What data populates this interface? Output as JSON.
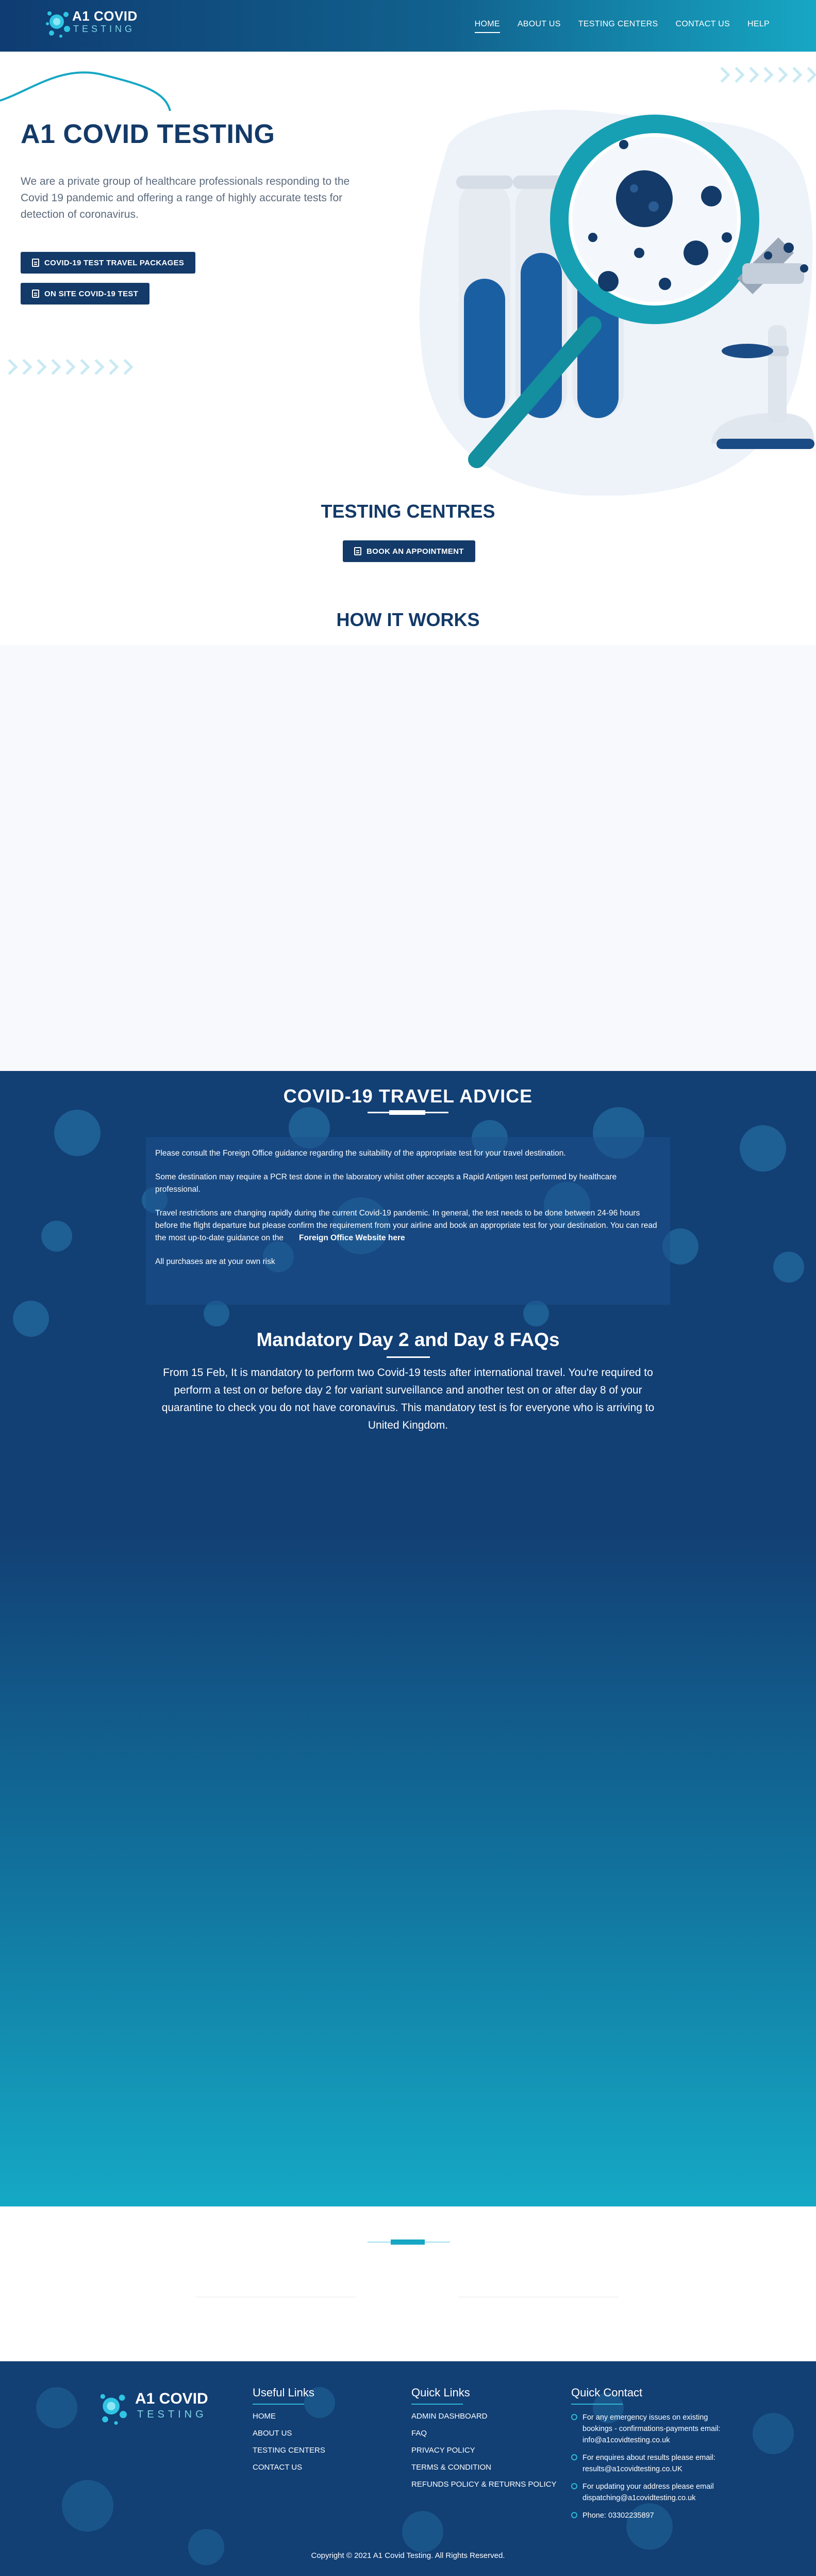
{
  "brand": {
    "name": "A1 COVID",
    "tagline": "TESTING"
  },
  "nav": {
    "items": [
      {
        "label": "HOME",
        "active": true
      },
      {
        "label": "ABOUT US"
      },
      {
        "label": "TESTING CENTERS"
      },
      {
        "label": "CONTACT US"
      },
      {
        "label": "HELP"
      }
    ]
  },
  "hero": {
    "title": "A1 COVID TESTING",
    "text": "We are a private group of healthcare professionals responding to the Covid 19 pandemic and offering a range of highly accurate tests for detection of coronavirus.",
    "button_packages": "COVID-19 TEST TRAVEL PACKAGES",
    "button_onsite": "ON SITE COVID-19 TEST"
  },
  "centres": {
    "title": "TESTING CENTRES",
    "button": "BOOK AN APPOINTMENT"
  },
  "how": {
    "title": "HOW IT WORKS"
  },
  "advice": {
    "title": "COVID-19 TRAVEL ADVICE",
    "p1": "Please consult the Foreign Office guidance regarding the suitability of the appropriate test for your travel destination.",
    "p2": "Some destination may require a PCR test done in the laboratory whilst other accepts a Rapid Antigen test performed by healthcare professional.",
    "p3": "Travel restrictions are changing rapidly during the current Covid-19 pandemic. In general, the test needs to be done between 24-96 hours before the flight departure but please confirm the requirement from your airline and book an appropriate test for your destination. You can read the most up-to-date guidance on the",
    "p3_link": "Foreign Office Website here",
    "p4": "All purchases are at your own risk"
  },
  "faq": {
    "title": "Mandatory Day 2 and Day 8 FAQs",
    "text": "From 15 Feb, It is mandatory to perform two Covid-19 tests after international travel. You're required to perform a test on or before day 2 for variant surveillance and another test on or after day 8 of your quarantine to check you do not have coronavirus. This mandatory test is for everyone who is arriving to United Kingdom."
  },
  "footer": {
    "useful": {
      "title": "Useful Links",
      "links": [
        "HOME",
        "ABOUT US",
        "TESTING CENTERS",
        "CONTACT US"
      ]
    },
    "quick": {
      "title": "Quick Links",
      "links": [
        "ADMIN DASHBOARD",
        "FAQ",
        "PRIVACY POLICY",
        "TERMS & CONDITION",
        "REFUNDS POLICY & RETURNS POLICY"
      ]
    },
    "contact": {
      "title": "Quick Contact",
      "items": [
        "For any emergency issues on existing bookings - confirmations-payments email: info@a1covidtesting.co.uk",
        "For enquires about results please email: results@a1covidtesting.co.UK",
        "For updating your address please email dispatching@a1covidtesting.co.uk",
        "Phone: 03302235897"
      ]
    },
    "copyright": "Copyright © 2021 A1 Covid Testing. All Rights Reserved."
  },
  "colors": {
    "navy": "#133a68",
    "teal": "#17a7c4",
    "light": "#f7f9fd"
  }
}
